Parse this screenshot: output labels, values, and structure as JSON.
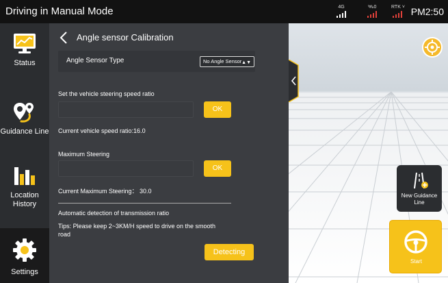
{
  "statusbar": {
    "title": "Driving in Manual Mode",
    "signal_4g": "4G",
    "satellites": "0",
    "rtk_label": "RTK",
    "time": "PM2:50"
  },
  "sidebar": {
    "items": [
      {
        "label": "Status",
        "icon": "monitor-chart-icon"
      },
      {
        "label": "Guidance Line",
        "icon": "route-pin-icon"
      },
      {
        "label": "Location History",
        "icon": "bar-chart-icon"
      },
      {
        "label": "Settings",
        "icon": "gear-icon"
      }
    ],
    "active": "Settings"
  },
  "panel": {
    "title": "Angle sensor Calibration",
    "sensor_type_label": "Angle Sensor Type",
    "sensor_type_value": "No Angle Sensor",
    "speed_ratio_label": "Set the vehicle steering speed ratio",
    "speed_ratio_input": "",
    "ok_label": "OK",
    "current_speed_ratio": "Current vehicle speed ratio:16.0",
    "max_steering_label": "Maximum Steering",
    "max_steering_input": "",
    "current_max_steering": "Current Maximum Steering： 30.0",
    "auto_detect_label": "Automatic detection of transmission ratio",
    "tips": "Tips: Please keep 2~3KM/H speed to drive on the smooth road",
    "detect_button": "Detecting"
  },
  "view": {
    "new_guidance_line": "New Guidance Line",
    "start": "Start"
  },
  "colors": {
    "accent": "#f6c21a",
    "panel": "#3b3d41",
    "sidebar": "#2b2d30",
    "statusbar": "#121212"
  }
}
